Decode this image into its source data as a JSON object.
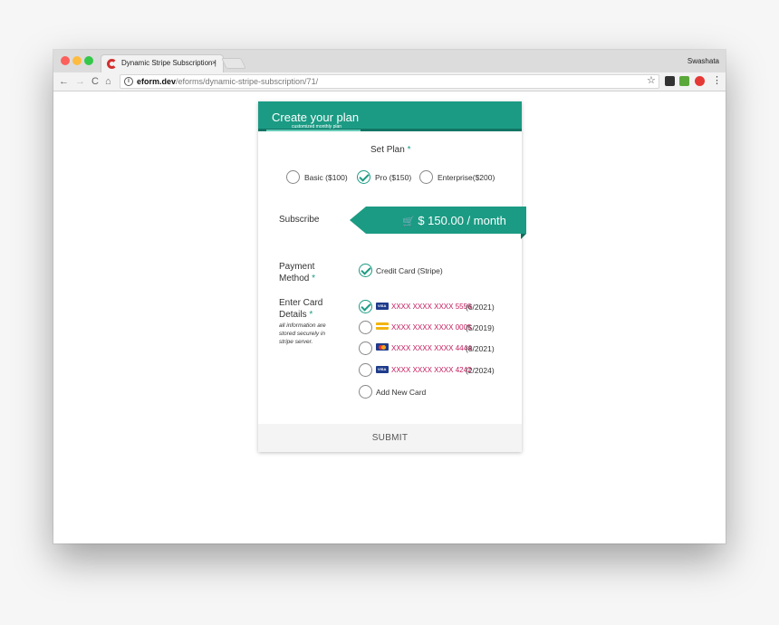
{
  "browser": {
    "tab_title": "Dynamic Stripe Subscription |",
    "tab_close": "×",
    "profile_name": "Swashata",
    "url_domain": "eform.dev",
    "url_path": "/eforms/dynamic-stripe-subscription/71/",
    "star_glyph": "☆",
    "menu_glyph": "⋮",
    "nav_back": "←",
    "nav_forward": "→",
    "nav_reload": "C",
    "nav_home": "⌂",
    "info_glyph": "i"
  },
  "form": {
    "title": "Create your plan",
    "subtitle": "customized monthly plan",
    "accent_color": "#1b9b84",
    "required_mark": "*",
    "set_plan": {
      "label": "Set Plan",
      "options": [
        {
          "label": "Basic ($100)",
          "checked": false
        },
        {
          "label": "Pro ($150)",
          "checked": true
        },
        {
          "label": "Enterprise($200)",
          "checked": false
        }
      ]
    },
    "subscribe": {
      "label": "Subscribe",
      "price": "$ 150.00 / month",
      "cart_icon": "cart-icon"
    },
    "payment_method": {
      "label_line1": "Payment",
      "label_line2": "Method",
      "option": "Credit Card (Stripe)"
    },
    "card_details": {
      "label_line1": "Enter Card",
      "label_line2": "Details",
      "note": "all information are stored securely in stripe server.",
      "cards": [
        {
          "brand": "visa",
          "number": "XXXX XXXX XXXX 5556",
          "expiry": "(6/2021)",
          "checked": true
        },
        {
          "brand": "gold",
          "number": "XXXX XXXX XXXX 0005",
          "expiry": "(5/2019)",
          "checked": false
        },
        {
          "brand": "mastercard",
          "number": "XXXX XXXX XXXX 4444",
          "expiry": "(8/2021)",
          "checked": false
        },
        {
          "brand": "visa",
          "number": "XXXX XXXX XXXX 4242",
          "expiry": "(2/2024)",
          "checked": false
        }
      ],
      "add_new": "Add New Card"
    },
    "submit_label": "SUBMIT"
  }
}
